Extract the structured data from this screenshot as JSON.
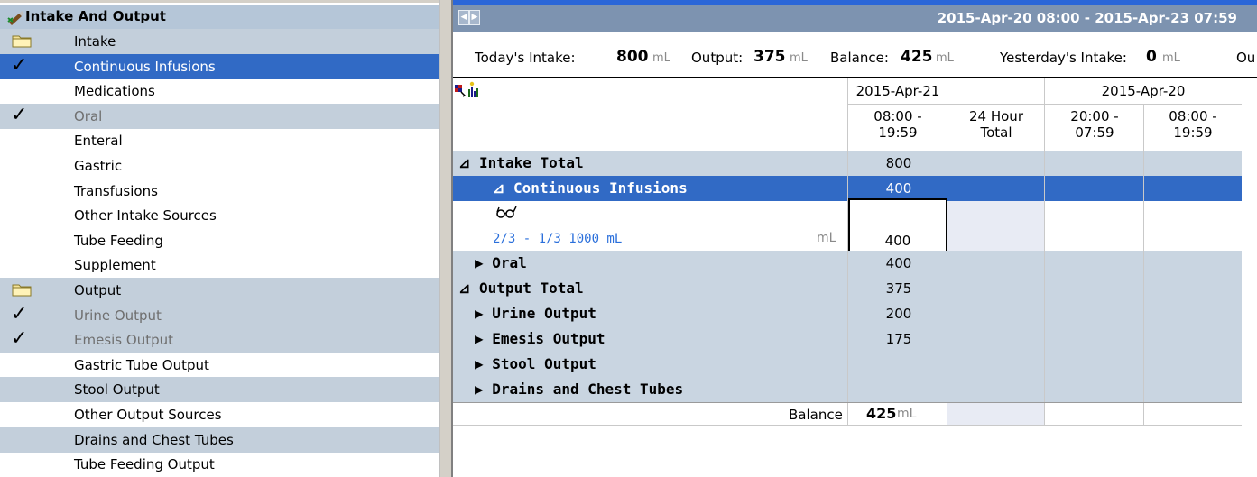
{
  "navigator": {
    "title": "Intake And Output",
    "items": [
      {
        "label": "Intake",
        "icon": "folder-icon",
        "checked": false,
        "shaded": true,
        "selected": false,
        "dim": false
      },
      {
        "label": "Continuous Infusions",
        "icon": "",
        "checked": true,
        "shaded": false,
        "selected": true,
        "dim": false
      },
      {
        "label": "Medications",
        "icon": "",
        "checked": false,
        "shaded": false,
        "selected": false,
        "dim": false
      },
      {
        "label": "Oral",
        "icon": "",
        "checked": true,
        "shaded": true,
        "selected": false,
        "dim": true
      },
      {
        "label": "Enteral",
        "icon": "",
        "checked": false,
        "shaded": false,
        "selected": false,
        "dim": false
      },
      {
        "label": "Gastric",
        "icon": "",
        "checked": false,
        "shaded": false,
        "selected": false,
        "dim": false
      },
      {
        "label": "Transfusions",
        "icon": "",
        "checked": false,
        "shaded": false,
        "selected": false,
        "dim": false
      },
      {
        "label": "Other Intake Sources",
        "icon": "",
        "checked": false,
        "shaded": false,
        "selected": false,
        "dim": false
      },
      {
        "label": "Tube Feeding",
        "icon": "",
        "checked": false,
        "shaded": false,
        "selected": false,
        "dim": false
      },
      {
        "label": "Supplement",
        "icon": "",
        "checked": false,
        "shaded": false,
        "selected": false,
        "dim": false
      },
      {
        "label": "Output",
        "icon": "folder-icon",
        "checked": false,
        "shaded": true,
        "selected": false,
        "dim": false
      },
      {
        "label": "Urine Output",
        "icon": "",
        "checked": true,
        "shaded": true,
        "selected": false,
        "dim": true
      },
      {
        "label": "Emesis Output",
        "icon": "",
        "checked": true,
        "shaded": true,
        "selected": false,
        "dim": true
      },
      {
        "label": "Gastric Tube Output",
        "icon": "",
        "checked": false,
        "shaded": false,
        "selected": false,
        "dim": false
      },
      {
        "label": "Stool Output",
        "icon": "",
        "checked": false,
        "shaded": true,
        "selected": false,
        "dim": false
      },
      {
        "label": "Other Output Sources",
        "icon": "",
        "checked": false,
        "shaded": false,
        "selected": false,
        "dim": false
      },
      {
        "label": "Drains and Chest Tubes",
        "icon": "",
        "checked": false,
        "shaded": true,
        "selected": false,
        "dim": false
      },
      {
        "label": "Tube Feeding Output",
        "icon": "",
        "checked": false,
        "shaded": false,
        "selected": false,
        "dim": false
      }
    ]
  },
  "flowsheet": {
    "date_range": "2015-Apr-20 08:00 - 2015-Apr-23 07:59",
    "summary": {
      "today_label": "Today's Intake:",
      "today_intake": "800",
      "output_label": "Output:",
      "output": "375",
      "balance_label": "Balance:",
      "balance": "425",
      "yesterday_label": "Yesterday's Intake:",
      "yesterday_intake": "0",
      "cut_label": "Ou",
      "unit": "mL"
    },
    "columns": {
      "date1": "2015-Apr-21",
      "date2": "2015-Apr-20",
      "col1_a": "08:00 -",
      "col1_b": "19:59",
      "col2_a": "24 Hour",
      "col2_b": "Total",
      "col3_a": "20:00 -",
      "col3_b": "07:59",
      "col4_a": "08:00 -",
      "col4_b": "19:59"
    },
    "rows": {
      "intake_total": {
        "label": "⊿ Intake Total",
        "value": "800"
      },
      "continuous_infusions": {
        "label": "⊿ Continuous Infusions",
        "value": "400"
      },
      "infusion_item": {
        "label": "2/3 - 1/3 1000 mL",
        "unit": "mL",
        "value": "400"
      },
      "oral": {
        "label": "▶ Oral",
        "value": "400"
      },
      "output_total": {
        "label": "⊿ Output Total",
        "value": "375"
      },
      "urine_output": {
        "label": "▶ Urine Output",
        "value": "200"
      },
      "emesis_output": {
        "label": "▶ Emesis Output",
        "value": "175"
      },
      "stool_output": {
        "label": "▶ Stool Output",
        "value": ""
      },
      "drains": {
        "label": "▶ Drains and Chest Tubes",
        "value": ""
      },
      "balance": {
        "label": "Balance",
        "value": "425",
        "unit": "mL"
      }
    }
  },
  "colors": {
    "selection": "#316ac5",
    "row_shade": "#c9d5e1",
    "date_bar": "#7d93b0",
    "link_blue": "#2a6fdb"
  }
}
